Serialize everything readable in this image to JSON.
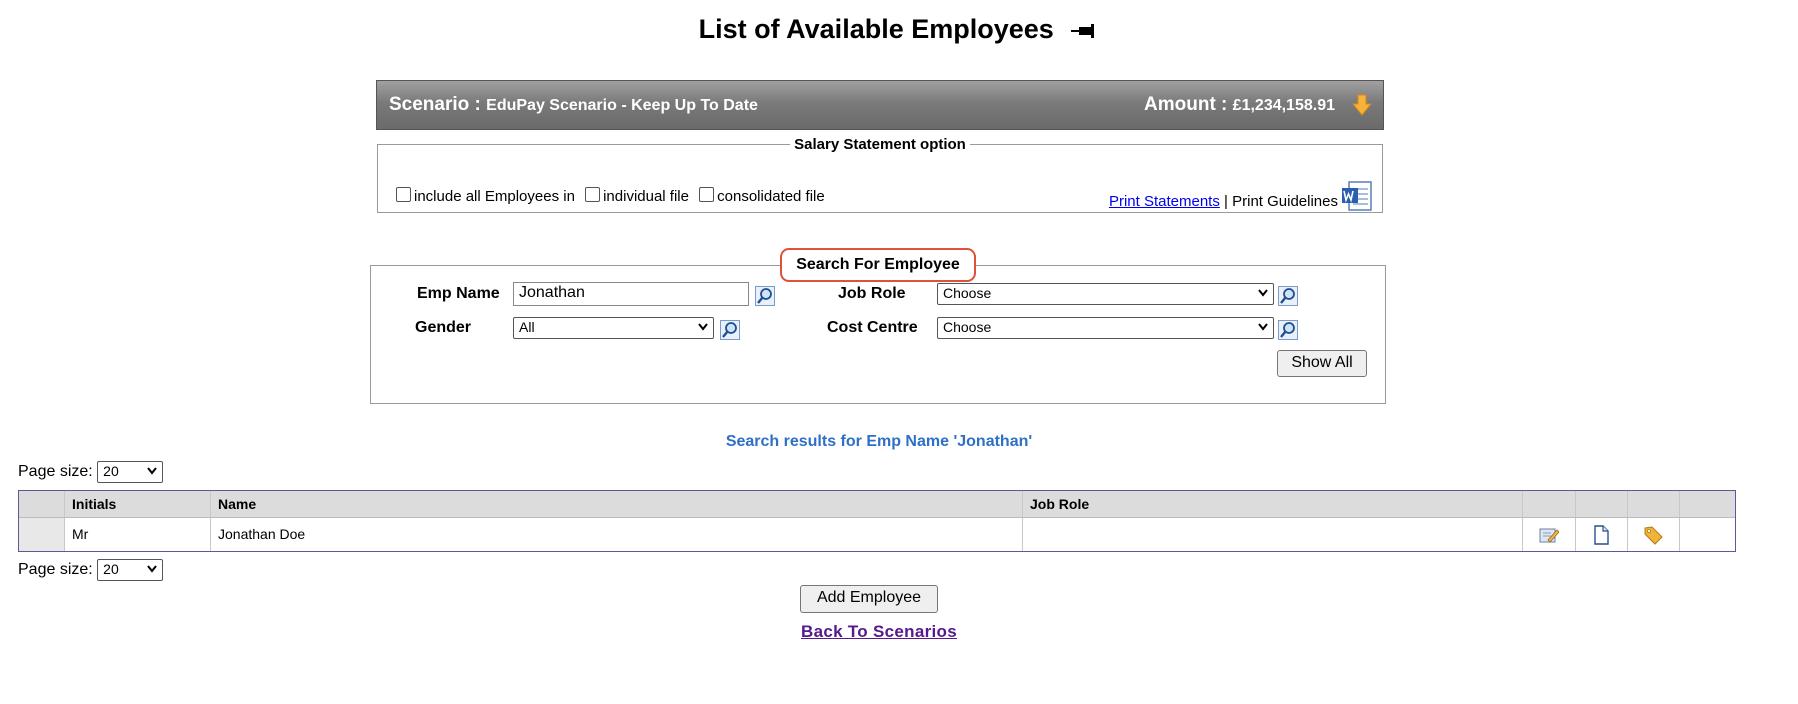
{
  "page": {
    "title": "List of Available Employees"
  },
  "scenario": {
    "label": "Scenario :",
    "name": "EduPay Scenario - Keep Up To Date",
    "amount_label": "Amount :",
    "amount": "£1,234,158.91"
  },
  "salary_statement": {
    "legend": "Salary Statement option",
    "include_all_label": "include all Employees in",
    "individual_label": "individual file",
    "consolidated_label": "consolidated file",
    "print_statements": "Print Statements",
    "separator": "|",
    "print_guidelines": "Print Guidelines"
  },
  "search": {
    "legend": "Search For Employee",
    "emp_name_label": "Emp Name",
    "emp_name_value": "Jonathan",
    "job_role_label": "Job Role",
    "job_role_value": "Choose",
    "gender_label": "Gender",
    "gender_value": "All",
    "cost_centre_label": "Cost Centre",
    "cost_centre_value": "Choose",
    "show_all": "Show All"
  },
  "results": {
    "caption": "Search results for Emp Name 'Jonathan'",
    "page_size_label": "Page size:",
    "page_size_value": "20",
    "columns": [
      "Initials",
      "Name",
      "Job Role"
    ],
    "rows": [
      {
        "initials": "Mr",
        "name": "Jonathan Doe",
        "job_role": ""
      }
    ]
  },
  "actions": {
    "add_employee": "Add Employee",
    "back_to_scenarios": "Back To Scenarios"
  },
  "colors": {
    "highlight_border": "#e0513c",
    "caption_blue": "#2e70c8",
    "visited_link": "#551a8b"
  }
}
